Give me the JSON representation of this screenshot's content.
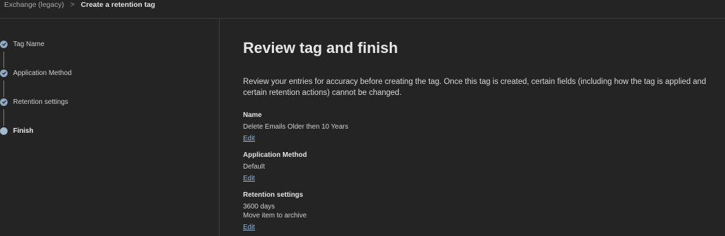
{
  "breadcrumb": {
    "parent": "Exchange (legacy)",
    "separator": ">",
    "current": "Create a retention tag"
  },
  "steps": [
    {
      "label": "Tag Name",
      "status": "completed",
      "icon": "check-icon"
    },
    {
      "label": "Application Method",
      "status": "completed",
      "icon": "check-icon"
    },
    {
      "label": "Retention settings",
      "status": "completed",
      "icon": "check-icon"
    },
    {
      "label": "Finish",
      "status": "current",
      "icon": "circle-icon"
    }
  ],
  "main": {
    "title": "Review tag and finish",
    "intro": "Review your entries for accuracy before creating the tag. Once this tag is created, certain fields (including how the tag is applied and certain retention actions) cannot be changed.",
    "sections": [
      {
        "label": "Name",
        "values": [
          "Delete Emails Older then 10 Years"
        ],
        "edit": "Edit"
      },
      {
        "label": "Application Method",
        "values": [
          "Default"
        ],
        "edit": "Edit"
      },
      {
        "label": "Retention settings",
        "values": [
          "3600 days",
          "Move item to archive"
        ],
        "edit": "Edit"
      }
    ]
  },
  "colors": {
    "background": "#242424",
    "accent": "#8fa9c2",
    "link": "#9ab6d6"
  }
}
